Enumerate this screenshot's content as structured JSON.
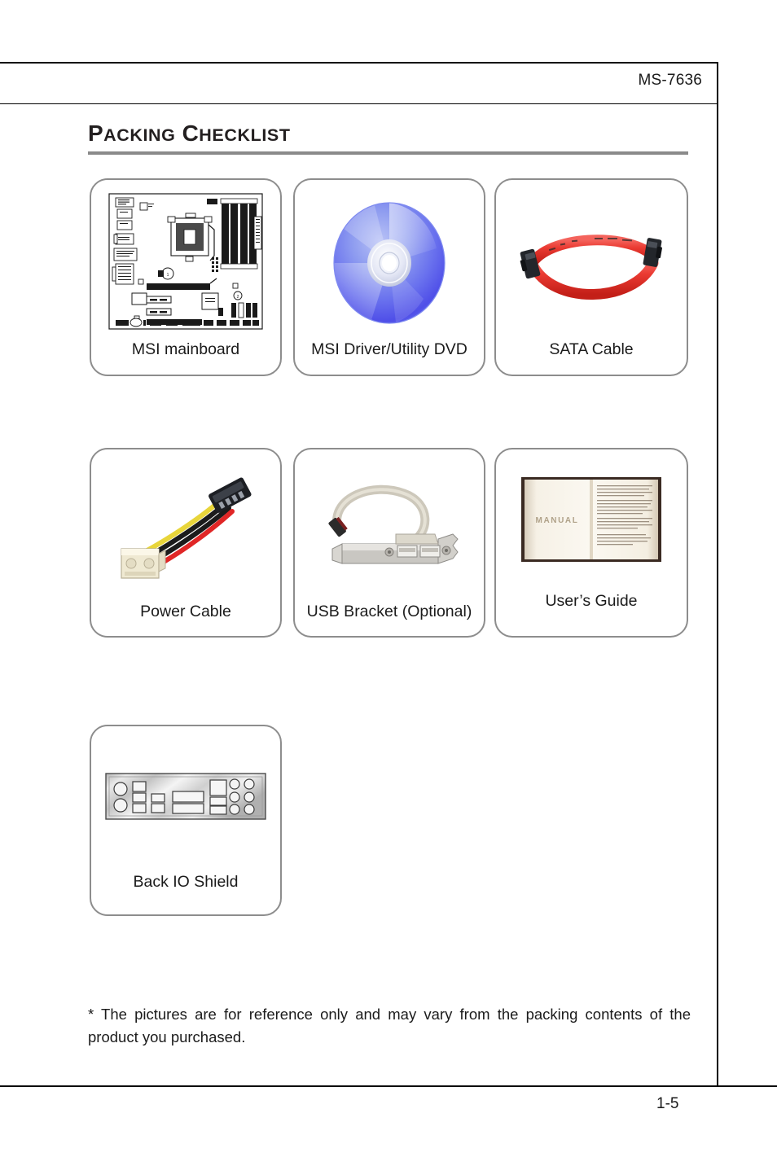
{
  "header": {
    "model_code": "MS-7636"
  },
  "section": {
    "title_first_letter": "P",
    "title_first_rest": "ACKING",
    "title_second_letter": "C",
    "title_second_rest": "HECKLIST",
    "title_full": "Packing Checklist"
  },
  "items": [
    {
      "id": "mainboard",
      "label": "MSI mainboard",
      "icon": "motherboard-illustration"
    },
    {
      "id": "dvd",
      "label": "MSI Driver/Utility DVD",
      "icon": "optical-disc-icon"
    },
    {
      "id": "sata",
      "label": "SATA Cable",
      "icon": "sata-cable-icon"
    },
    {
      "id": "power",
      "label": "Power Cable",
      "icon": "power-cable-icon"
    },
    {
      "id": "usb",
      "label": "USB Bracket (Optional)",
      "icon": "usb-bracket-icon"
    },
    {
      "id": "guide",
      "label": "User’s Guide",
      "icon": "manual-book-icon"
    },
    {
      "id": "ioshield",
      "label": "Back IO Shield",
      "icon": "io-shield-icon"
    }
  ],
  "manual_cover_text": "MANUAL",
  "footnote": "* The pictures are for reference only and may vary from the packing contents of the product you purchased.",
  "page_number": "1-5",
  "colors": {
    "rule_gray": "#8a8a8a",
    "box_border": "#8d8d8d",
    "text": "#1b1b1b",
    "disc_blue": "#4a4ee8",
    "cable_red": "#e8312a",
    "bracket_gray": "#cfcabc"
  }
}
